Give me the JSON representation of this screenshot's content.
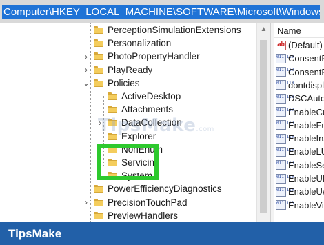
{
  "address_bar": {
    "path": "Computer\\HKEY_LOCAL_MACHINE\\SOFTWARE\\Microsoft\\Windows\\CurrentVersion"
  },
  "tree": {
    "items": [
      {
        "label": "PerceptionSimulationExtensions",
        "indent": 0,
        "expander": ""
      },
      {
        "label": "Personalization",
        "indent": 0,
        "expander": ""
      },
      {
        "label": "PhotoPropertyHandler",
        "indent": 0,
        "expander": "›"
      },
      {
        "label": "PlayReady",
        "indent": 0,
        "expander": "›"
      },
      {
        "label": "Policies",
        "indent": 0,
        "expander": "⌄"
      },
      {
        "label": "ActiveDesktop",
        "indent": 1,
        "expander": ""
      },
      {
        "label": "Attachments",
        "indent": 1,
        "expander": ""
      },
      {
        "label": "DataCollection",
        "indent": 1,
        "expander": "›"
      },
      {
        "label": "Explorer",
        "indent": 1,
        "expander": ""
      },
      {
        "label": "NonEnum",
        "indent": 1,
        "expander": ""
      },
      {
        "label": "Servicing",
        "indent": 1,
        "expander": ""
      },
      {
        "label": "System",
        "indent": 1,
        "expander": ""
      },
      {
        "label": "PowerEfficiencyDiagnostics",
        "indent": 0,
        "expander": ""
      },
      {
        "label": "PrecisionTouchPad",
        "indent": 0,
        "expander": "›"
      },
      {
        "label": "PreviewHandlers",
        "indent": 0,
        "expander": ""
      }
    ]
  },
  "values_panel": {
    "header": "Name",
    "items": [
      {
        "icon": "string-value-icon",
        "label": "(Default)"
      },
      {
        "icon": "dword-value-icon",
        "label": "ConsentPromptBehaviorAdmin"
      },
      {
        "icon": "dword-value-icon",
        "label": "ConsentPromptBehaviorUser"
      },
      {
        "icon": "dword-value-icon",
        "label": "dontdisplaylastusername"
      },
      {
        "icon": "dword-value-icon",
        "label": "DSCAutomationHostEnabled"
      },
      {
        "icon": "dword-value-icon",
        "label": "EnableCursorSuppression"
      },
      {
        "icon": "dword-value-icon",
        "label": "EnableFullTrustStartupTasks"
      },
      {
        "icon": "dword-value-icon",
        "label": "EnableInstallerDetection"
      },
      {
        "icon": "dword-value-icon",
        "label": "EnableLUA"
      },
      {
        "icon": "dword-value-icon",
        "label": "EnableSecureUIAPaths"
      },
      {
        "icon": "dword-value-icon",
        "label": "EnableUIADesktopToggle"
      },
      {
        "icon": "dword-value-icon",
        "label": "EnableUwpStartupTasks"
      },
      {
        "icon": "dword-value-icon",
        "label": "EnableVirtualization"
      }
    ]
  },
  "watermark": {
    "text": "TipsMake",
    "suffix": ".com"
  },
  "footer": {
    "brand": "TipsMake"
  },
  "colors": {
    "address_bg": "#1f73d6",
    "highlight": "#2ec92e",
    "footer_bg": "#2260a8"
  }
}
